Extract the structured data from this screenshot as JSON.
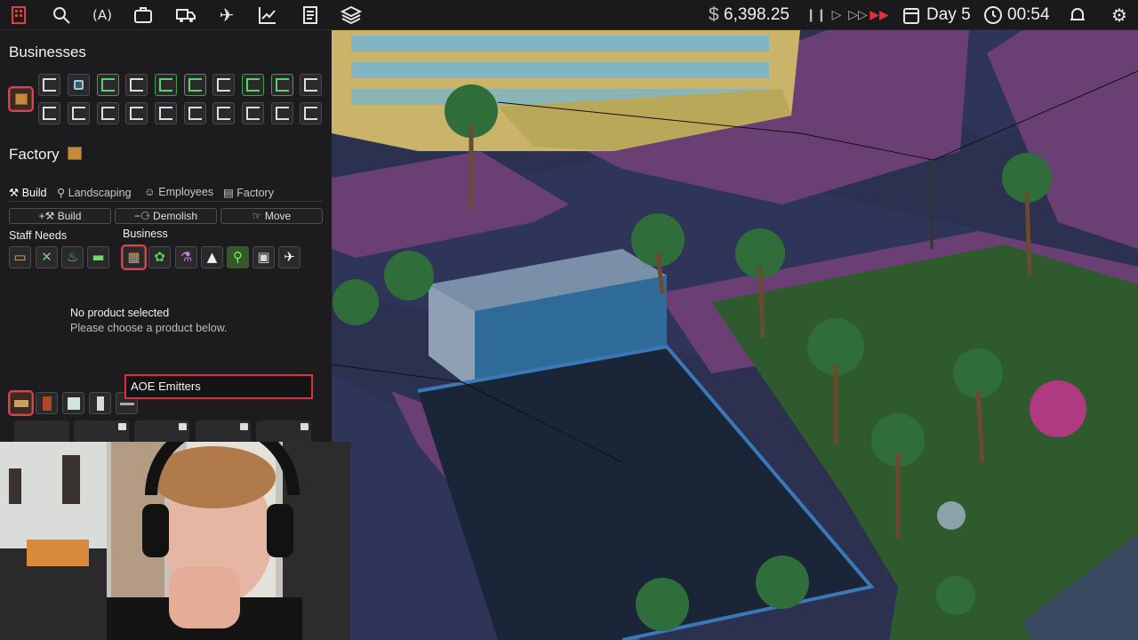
{
  "topbar": {
    "icons": [
      "business-icon",
      "search-location-icon",
      "marketing-icon",
      "briefcase-icon",
      "delivery-truck-icon",
      "airplane-icon",
      "chart-icon",
      "ledger-icon",
      "layers-icon"
    ],
    "money": "6,398.25",
    "currency_symbol": "$",
    "day": "Day 5",
    "time": "00:54",
    "fast_forward_active_color": "#e0303a"
  },
  "sidebar": {
    "businesses_title": "Businesses",
    "factory_title": "Factory",
    "tabs": [
      "Build",
      "Landscaping",
      "Employees",
      "Factory"
    ],
    "actions": [
      "Build",
      "Demolish",
      "Move"
    ],
    "staff_needs_label": "Staff Needs",
    "business_label": "Business",
    "staff_needs_icons": [
      "tv-icon",
      "tools-icon",
      "toilet-icon",
      "bed-icon"
    ],
    "business_icons": [
      "box-icon",
      "cannabis-icon",
      "flask-icon",
      "mountain-icon",
      "runner-icon",
      "bus-icon",
      "plane-icon"
    ],
    "no_product_title": "No product selected",
    "no_product_hint": "Please choose a product below.",
    "search_value": "AOE Emitters",
    "accent_color": "#d8333d"
  }
}
